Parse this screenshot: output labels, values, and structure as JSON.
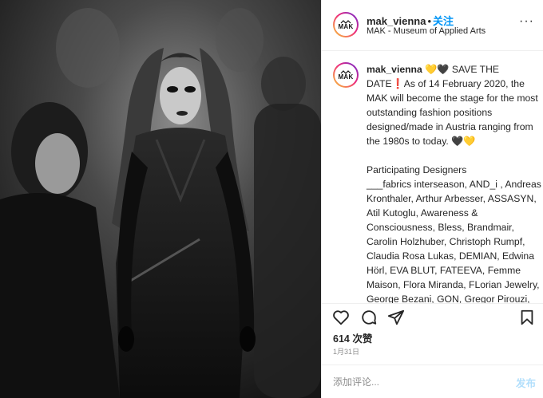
{
  "post": {
    "username": "mak_vienna",
    "separator": "•",
    "follow_label": "关注",
    "location": "MAK - Museum of Applied Arts",
    "avatar_text": "MAK",
    "more_label": "···"
  },
  "caption": {
    "username": "mak_vienna",
    "text": " 💛🖤 SAVE THE DATE❗As of 14 February 2020, the MAK will become the stage for the most outstanding fashion positions designed/made in Austria ranging from the 1980s to today. 🖤💛\n\nParticipating Designers\n___fabrics interseason, AND_i , Andreas Kronthaler, Arthur Arbesser, ASSASYN, Atil Kutoglu, Awareness & Consciousness, Bless, Brandmair, Carolin Holzhuber, Christoph Rumpf, Claudia Rosa Lukas, DEMIAN, Edwina Hörl, EVA BLUT, FATEEVA, Femme Maison, Flora Miranda, FLorian Jewelry, George Bezani, GON, Gregor Pirouzi, Hartmann Nordenholz, Helmut Lang, House of the very island's, Jana Wieland, Karin"
  },
  "actions": {
    "like_icon": "heart-icon",
    "comment_icon": "comment-bubble-icon",
    "share_icon": "paper-plane-icon",
    "save_icon": "bookmark-icon"
  },
  "likes": "614 次赞",
  "date": "1月31日",
  "comment_box": {
    "placeholder": "添加评论...",
    "post_label": "发布"
  },
  "colors": {
    "follow_blue": "#0095f6",
    "post_disabled_blue": "#b2dffc",
    "text": "#262626",
    "muted": "#8e8e8e",
    "border": "#efefef"
  }
}
